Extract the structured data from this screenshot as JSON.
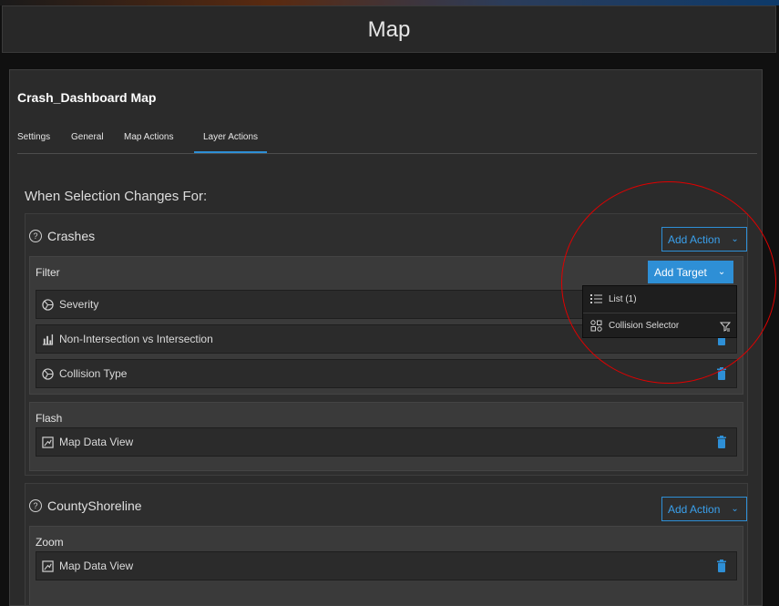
{
  "header": {
    "title": "Map"
  },
  "panel": {
    "title": "Crash_Dashboard Map",
    "tabs": [
      {
        "label": "Settings",
        "active": false
      },
      {
        "label": "General",
        "active": false
      },
      {
        "label": "Map Actions",
        "active": false
      },
      {
        "label": "Layer Actions",
        "active": true
      }
    ],
    "section_heading": "When Selection Changes For:"
  },
  "groups": [
    {
      "name": "Crashes",
      "add_action_label": "Add Action",
      "actions": [
        {
          "name": "Filter",
          "add_target_label": "Add Target",
          "targets": [
            {
              "label": "Severity",
              "icon": "pie-chart-icon"
            },
            {
              "label": "Non-Intersection vs Intersection",
              "icon": "bar-chart-icon"
            },
            {
              "label": "Collision Type",
              "icon": "pie-chart-icon"
            }
          ]
        },
        {
          "name": "Flash",
          "targets": [
            {
              "label": "Map Data View",
              "icon": "map-view-icon"
            }
          ]
        }
      ]
    },
    {
      "name": "CountyShoreline",
      "add_action_label": "Add Action",
      "actions": [
        {
          "name": "Zoom",
          "targets": [
            {
              "label": "Map Data View",
              "icon": "map-view-icon"
            }
          ]
        }
      ]
    }
  ],
  "dropdown": {
    "items": [
      {
        "label": "List (1)",
        "icon": "list-icon"
      },
      {
        "label": "Collision Selector",
        "icon": "grid-icon",
        "end_icon": "filter-settings-icon"
      }
    ]
  },
  "colors": {
    "accent": "#2e8fd6",
    "annotation": "#e00000",
    "trash": "#2e8fd6"
  }
}
